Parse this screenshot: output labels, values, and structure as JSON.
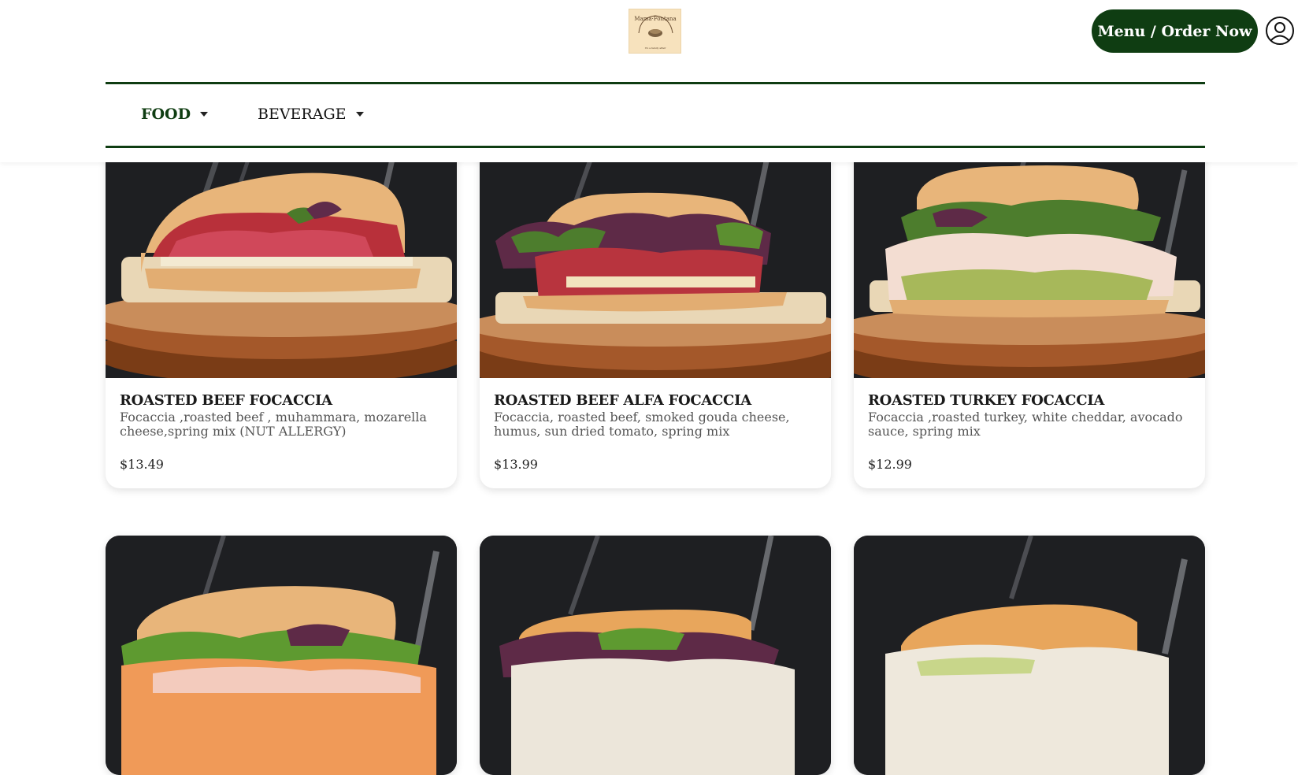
{
  "brand": {
    "logo_text": "Mama Fontana",
    "logo_tagline": "It's a family affair"
  },
  "header": {
    "order_button_label": "Menu / Order Now",
    "account_icon": "user-circle-icon"
  },
  "nav": {
    "items": [
      {
        "label": "FOOD",
        "active": true,
        "icon": "caret-down-icon"
      },
      {
        "label": "BEVERAGE",
        "active": false,
        "icon": "caret-down-icon"
      }
    ]
  },
  "colors": {
    "brand_green": "#0f3d12",
    "logo_bg": "#f7e2bd",
    "photo_bg": "#1e1f22"
  },
  "products": [
    {
      "name": "ROASTED BEEF FOCACCIA",
      "description": "Focaccia ,roasted beef , muhammara, mozarella cheese,spring mix (NUT ALLERGY)",
      "price": "$13.49",
      "filling": "roast-beef"
    },
    {
      "name": "ROASTED BEEF ALFA FOCACCIA",
      "description": "Focaccia, roasted beef, smoked gouda cheese, humus, sun dried tomato, spring mix",
      "price": "$13.99",
      "filling": "roast-beef-greens"
    },
    {
      "name": "ROASTED TURKEY FOCACCIA",
      "description": "Focaccia ,roasted turkey, white cheddar, avocado sauce, spring mix",
      "price": "$12.99",
      "filling": "turkey"
    },
    {
      "name": "",
      "description": "",
      "price": "",
      "filling": "ham-cheese"
    },
    {
      "name": "",
      "description": "",
      "price": "",
      "filling": "chicken-salad"
    },
    {
      "name": "",
      "description": "",
      "price": "",
      "filling": "slaw"
    }
  ]
}
